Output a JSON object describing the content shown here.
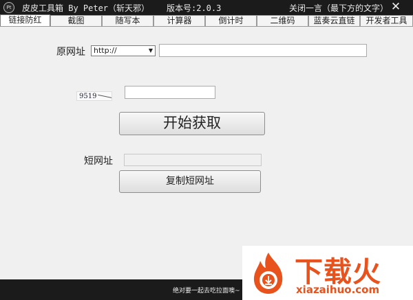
{
  "titlebar": {
    "app_icon_glyph": "Pt",
    "title": "皮皮工具箱 By Peter（斩天邪）",
    "version": "版本号:2.0.3",
    "close_one_liner": "关闭一言（最下方的文字）",
    "close_glyph": "✕"
  },
  "tabs": [
    "链接防红",
    "截图",
    "随写本",
    "计算器",
    "倒计时",
    "二维码",
    "蓝奏云直链",
    "开发者工具"
  ],
  "active_tab": "链接防红",
  "form": {
    "original_url_label": "原网址",
    "protocol_selected": "http://",
    "original_url_value": "",
    "captcha_text": "9519",
    "captcha_value": "",
    "fetch_button": "开始获取",
    "short_url_label": "短网址",
    "short_url_value": "",
    "copy_button": "复制短网址"
  },
  "footer": {
    "one_liner": "绝对要一起去吃拉面噢~"
  },
  "watermark": {
    "brand": "下载火",
    "url": "xiazaihuo.com"
  }
}
